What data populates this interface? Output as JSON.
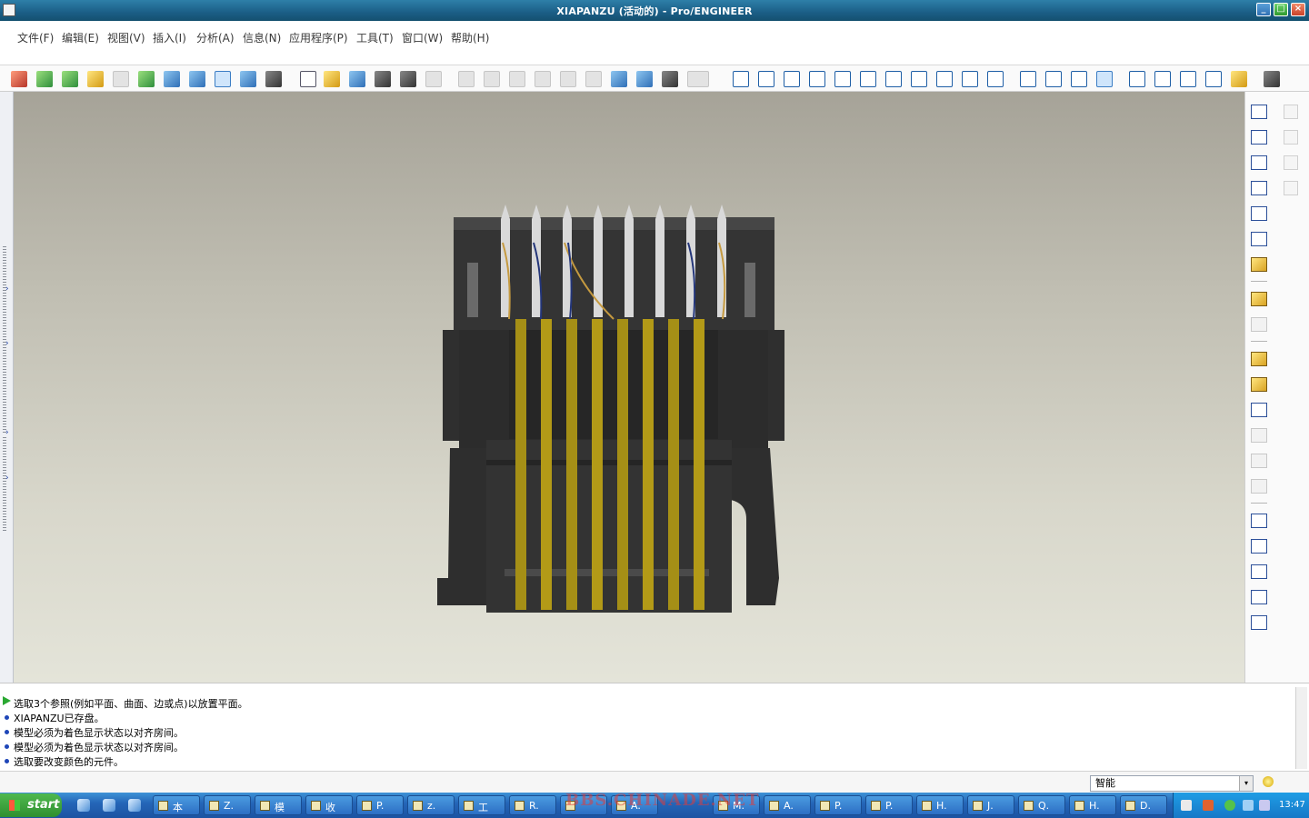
{
  "window": {
    "title": "XIAPANZU (活动的) - Pro/ENGINEER",
    "min_label": "_",
    "max_label": "□",
    "close_label": "×"
  },
  "menu": {
    "items": [
      "文件(F)",
      "编辑(E)",
      "视图(V)",
      "插入(I)",
      "分析(A)",
      "信息(N)",
      "应用程序(P)",
      "工具(T)",
      "窗口(W)",
      "帮助(H)"
    ]
  },
  "messages": [
    "选取3个参照(例如平面、曲面、边或点)以放置平面。",
    "XIAPANZU已存盘。",
    "模型必须为着色显示状态以对齐房间。",
    "模型必须为着色显示状态以对齐房间。",
    "选取要改变颜色的元件。"
  ],
  "status": {
    "filter_value": "智能",
    "filter_dropdown": "▾"
  },
  "taskbar": {
    "start_label": "start",
    "tasks": [
      "本",
      "Z.",
      "模",
      "收",
      "P.",
      "z.",
      "工",
      "R.",
      "",
      "A.",
      "M.",
      "A.",
      "P.",
      "P.",
      "H.",
      "J.",
      "Q.",
      "H.",
      "D."
    ],
    "clock": "13:47"
  },
  "watermark": "BBS.CHINADE.NET",
  "colors": {
    "titlebar": "#1b5e86",
    "viewport_top": "#a6a398",
    "viewport_bottom": "#e4e4d9",
    "model_body": "#303030",
    "pins": "#b39a17",
    "taskbar": "#2566b8"
  }
}
